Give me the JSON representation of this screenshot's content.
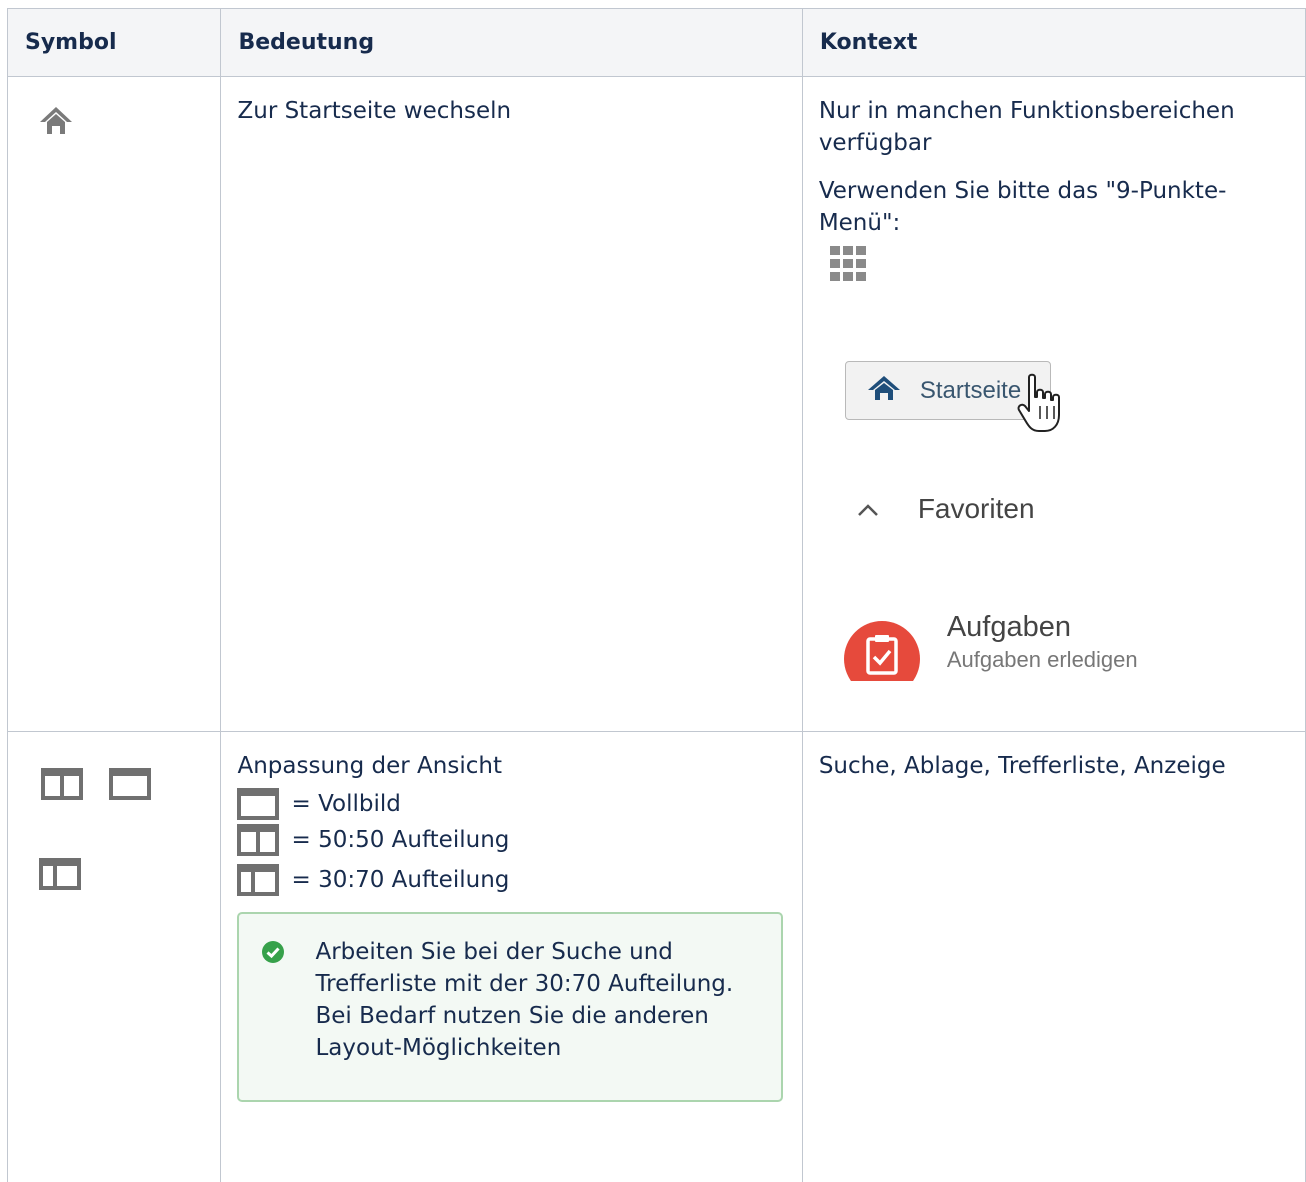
{
  "table": {
    "headers": {
      "symbol": "Symbol",
      "meaning": "Bedeutung",
      "context": "Kontext"
    },
    "rows": [
      {
        "icon": "home-icon",
        "meaning": "Zur Startseite wechseln",
        "context_line1": "Nur in manchen Funktionsbereichen verfügbar",
        "context_line2": "Verwenden Sie bitte das \"9-Punkte-Menü\":",
        "menu_icon": "nine-dot-grid-icon",
        "screenshot": {
          "start_button": "Startseite",
          "favorites": "Favoriten",
          "tasks": "Aufgaben",
          "tasks_sub": "Aufgaben erledigen"
        }
      },
      {
        "icons": [
          "split-50-50-icon",
          "fullscreen-icon",
          "split-30-70-icon"
        ],
        "meaning": "Anpassung der Ansicht",
        "layout_full": "= Vollbild",
        "layout_5050": "= 50:50 Aufteilung",
        "layout_3070": "= 30:70 Aufteilung",
        "tip": "Arbeiten Sie bei der Suche und Trefferliste mit der 30:70 Aufteilung. Bei Bedarf nutzen Sie die anderen Layout-Möglichkeiten",
        "context": "Suche, Ablage, Trefferliste, Anzeige"
      }
    ]
  },
  "colors": {
    "header_bg": "#f4f5f7",
    "border": "#c1c7d0",
    "tip_bg": "#f3f9f4",
    "tip_border": "#abd5ae",
    "check": "#36a14a",
    "tasks_red": "#e64a3c"
  }
}
